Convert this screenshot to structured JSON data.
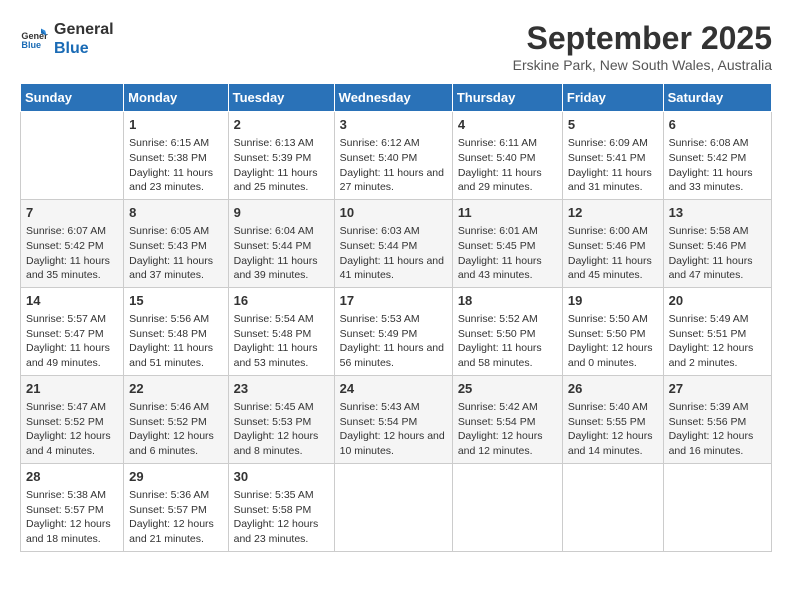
{
  "logo": {
    "line1": "General",
    "line2": "Blue"
  },
  "title": "September 2025",
  "subtitle": "Erskine Park, New South Wales, Australia",
  "days_of_week": [
    "Sunday",
    "Monday",
    "Tuesday",
    "Wednesday",
    "Thursday",
    "Friday",
    "Saturday"
  ],
  "weeks": [
    [
      {
        "day": "",
        "sunrise": "",
        "sunset": "",
        "daylight": ""
      },
      {
        "day": "1",
        "sunrise": "Sunrise: 6:15 AM",
        "sunset": "Sunset: 5:38 PM",
        "daylight": "Daylight: 11 hours and 23 minutes."
      },
      {
        "day": "2",
        "sunrise": "Sunrise: 6:13 AM",
        "sunset": "Sunset: 5:39 PM",
        "daylight": "Daylight: 11 hours and 25 minutes."
      },
      {
        "day": "3",
        "sunrise": "Sunrise: 6:12 AM",
        "sunset": "Sunset: 5:40 PM",
        "daylight": "Daylight: 11 hours and 27 minutes."
      },
      {
        "day": "4",
        "sunrise": "Sunrise: 6:11 AM",
        "sunset": "Sunset: 5:40 PM",
        "daylight": "Daylight: 11 hours and 29 minutes."
      },
      {
        "day": "5",
        "sunrise": "Sunrise: 6:09 AM",
        "sunset": "Sunset: 5:41 PM",
        "daylight": "Daylight: 11 hours and 31 minutes."
      },
      {
        "day": "6",
        "sunrise": "Sunrise: 6:08 AM",
        "sunset": "Sunset: 5:42 PM",
        "daylight": "Daylight: 11 hours and 33 minutes."
      }
    ],
    [
      {
        "day": "7",
        "sunrise": "Sunrise: 6:07 AM",
        "sunset": "Sunset: 5:42 PM",
        "daylight": "Daylight: 11 hours and 35 minutes."
      },
      {
        "day": "8",
        "sunrise": "Sunrise: 6:05 AM",
        "sunset": "Sunset: 5:43 PM",
        "daylight": "Daylight: 11 hours and 37 minutes."
      },
      {
        "day": "9",
        "sunrise": "Sunrise: 6:04 AM",
        "sunset": "Sunset: 5:44 PM",
        "daylight": "Daylight: 11 hours and 39 minutes."
      },
      {
        "day": "10",
        "sunrise": "Sunrise: 6:03 AM",
        "sunset": "Sunset: 5:44 PM",
        "daylight": "Daylight: 11 hours and 41 minutes."
      },
      {
        "day": "11",
        "sunrise": "Sunrise: 6:01 AM",
        "sunset": "Sunset: 5:45 PM",
        "daylight": "Daylight: 11 hours and 43 minutes."
      },
      {
        "day": "12",
        "sunrise": "Sunrise: 6:00 AM",
        "sunset": "Sunset: 5:46 PM",
        "daylight": "Daylight: 11 hours and 45 minutes."
      },
      {
        "day": "13",
        "sunrise": "Sunrise: 5:58 AM",
        "sunset": "Sunset: 5:46 PM",
        "daylight": "Daylight: 11 hours and 47 minutes."
      }
    ],
    [
      {
        "day": "14",
        "sunrise": "Sunrise: 5:57 AM",
        "sunset": "Sunset: 5:47 PM",
        "daylight": "Daylight: 11 hours and 49 minutes."
      },
      {
        "day": "15",
        "sunrise": "Sunrise: 5:56 AM",
        "sunset": "Sunset: 5:48 PM",
        "daylight": "Daylight: 11 hours and 51 minutes."
      },
      {
        "day": "16",
        "sunrise": "Sunrise: 5:54 AM",
        "sunset": "Sunset: 5:48 PM",
        "daylight": "Daylight: 11 hours and 53 minutes."
      },
      {
        "day": "17",
        "sunrise": "Sunrise: 5:53 AM",
        "sunset": "Sunset: 5:49 PM",
        "daylight": "Daylight: 11 hours and 56 minutes."
      },
      {
        "day": "18",
        "sunrise": "Sunrise: 5:52 AM",
        "sunset": "Sunset: 5:50 PM",
        "daylight": "Daylight: 11 hours and 58 minutes."
      },
      {
        "day": "19",
        "sunrise": "Sunrise: 5:50 AM",
        "sunset": "Sunset: 5:50 PM",
        "daylight": "Daylight: 12 hours and 0 minutes."
      },
      {
        "day": "20",
        "sunrise": "Sunrise: 5:49 AM",
        "sunset": "Sunset: 5:51 PM",
        "daylight": "Daylight: 12 hours and 2 minutes."
      }
    ],
    [
      {
        "day": "21",
        "sunrise": "Sunrise: 5:47 AM",
        "sunset": "Sunset: 5:52 PM",
        "daylight": "Daylight: 12 hours and 4 minutes."
      },
      {
        "day": "22",
        "sunrise": "Sunrise: 5:46 AM",
        "sunset": "Sunset: 5:52 PM",
        "daylight": "Daylight: 12 hours and 6 minutes."
      },
      {
        "day": "23",
        "sunrise": "Sunrise: 5:45 AM",
        "sunset": "Sunset: 5:53 PM",
        "daylight": "Daylight: 12 hours and 8 minutes."
      },
      {
        "day": "24",
        "sunrise": "Sunrise: 5:43 AM",
        "sunset": "Sunset: 5:54 PM",
        "daylight": "Daylight: 12 hours and 10 minutes."
      },
      {
        "day": "25",
        "sunrise": "Sunrise: 5:42 AM",
        "sunset": "Sunset: 5:54 PM",
        "daylight": "Daylight: 12 hours and 12 minutes."
      },
      {
        "day": "26",
        "sunrise": "Sunrise: 5:40 AM",
        "sunset": "Sunset: 5:55 PM",
        "daylight": "Daylight: 12 hours and 14 minutes."
      },
      {
        "day": "27",
        "sunrise": "Sunrise: 5:39 AM",
        "sunset": "Sunset: 5:56 PM",
        "daylight": "Daylight: 12 hours and 16 minutes."
      }
    ],
    [
      {
        "day": "28",
        "sunrise": "Sunrise: 5:38 AM",
        "sunset": "Sunset: 5:57 PM",
        "daylight": "Daylight: 12 hours and 18 minutes."
      },
      {
        "day": "29",
        "sunrise": "Sunrise: 5:36 AM",
        "sunset": "Sunset: 5:57 PM",
        "daylight": "Daylight: 12 hours and 21 minutes."
      },
      {
        "day": "30",
        "sunrise": "Sunrise: 5:35 AM",
        "sunset": "Sunset: 5:58 PM",
        "daylight": "Daylight: 12 hours and 23 minutes."
      },
      {
        "day": "",
        "sunrise": "",
        "sunset": "",
        "daylight": ""
      },
      {
        "day": "",
        "sunrise": "",
        "sunset": "",
        "daylight": ""
      },
      {
        "day": "",
        "sunrise": "",
        "sunset": "",
        "daylight": ""
      },
      {
        "day": "",
        "sunrise": "",
        "sunset": "",
        "daylight": ""
      }
    ]
  ]
}
